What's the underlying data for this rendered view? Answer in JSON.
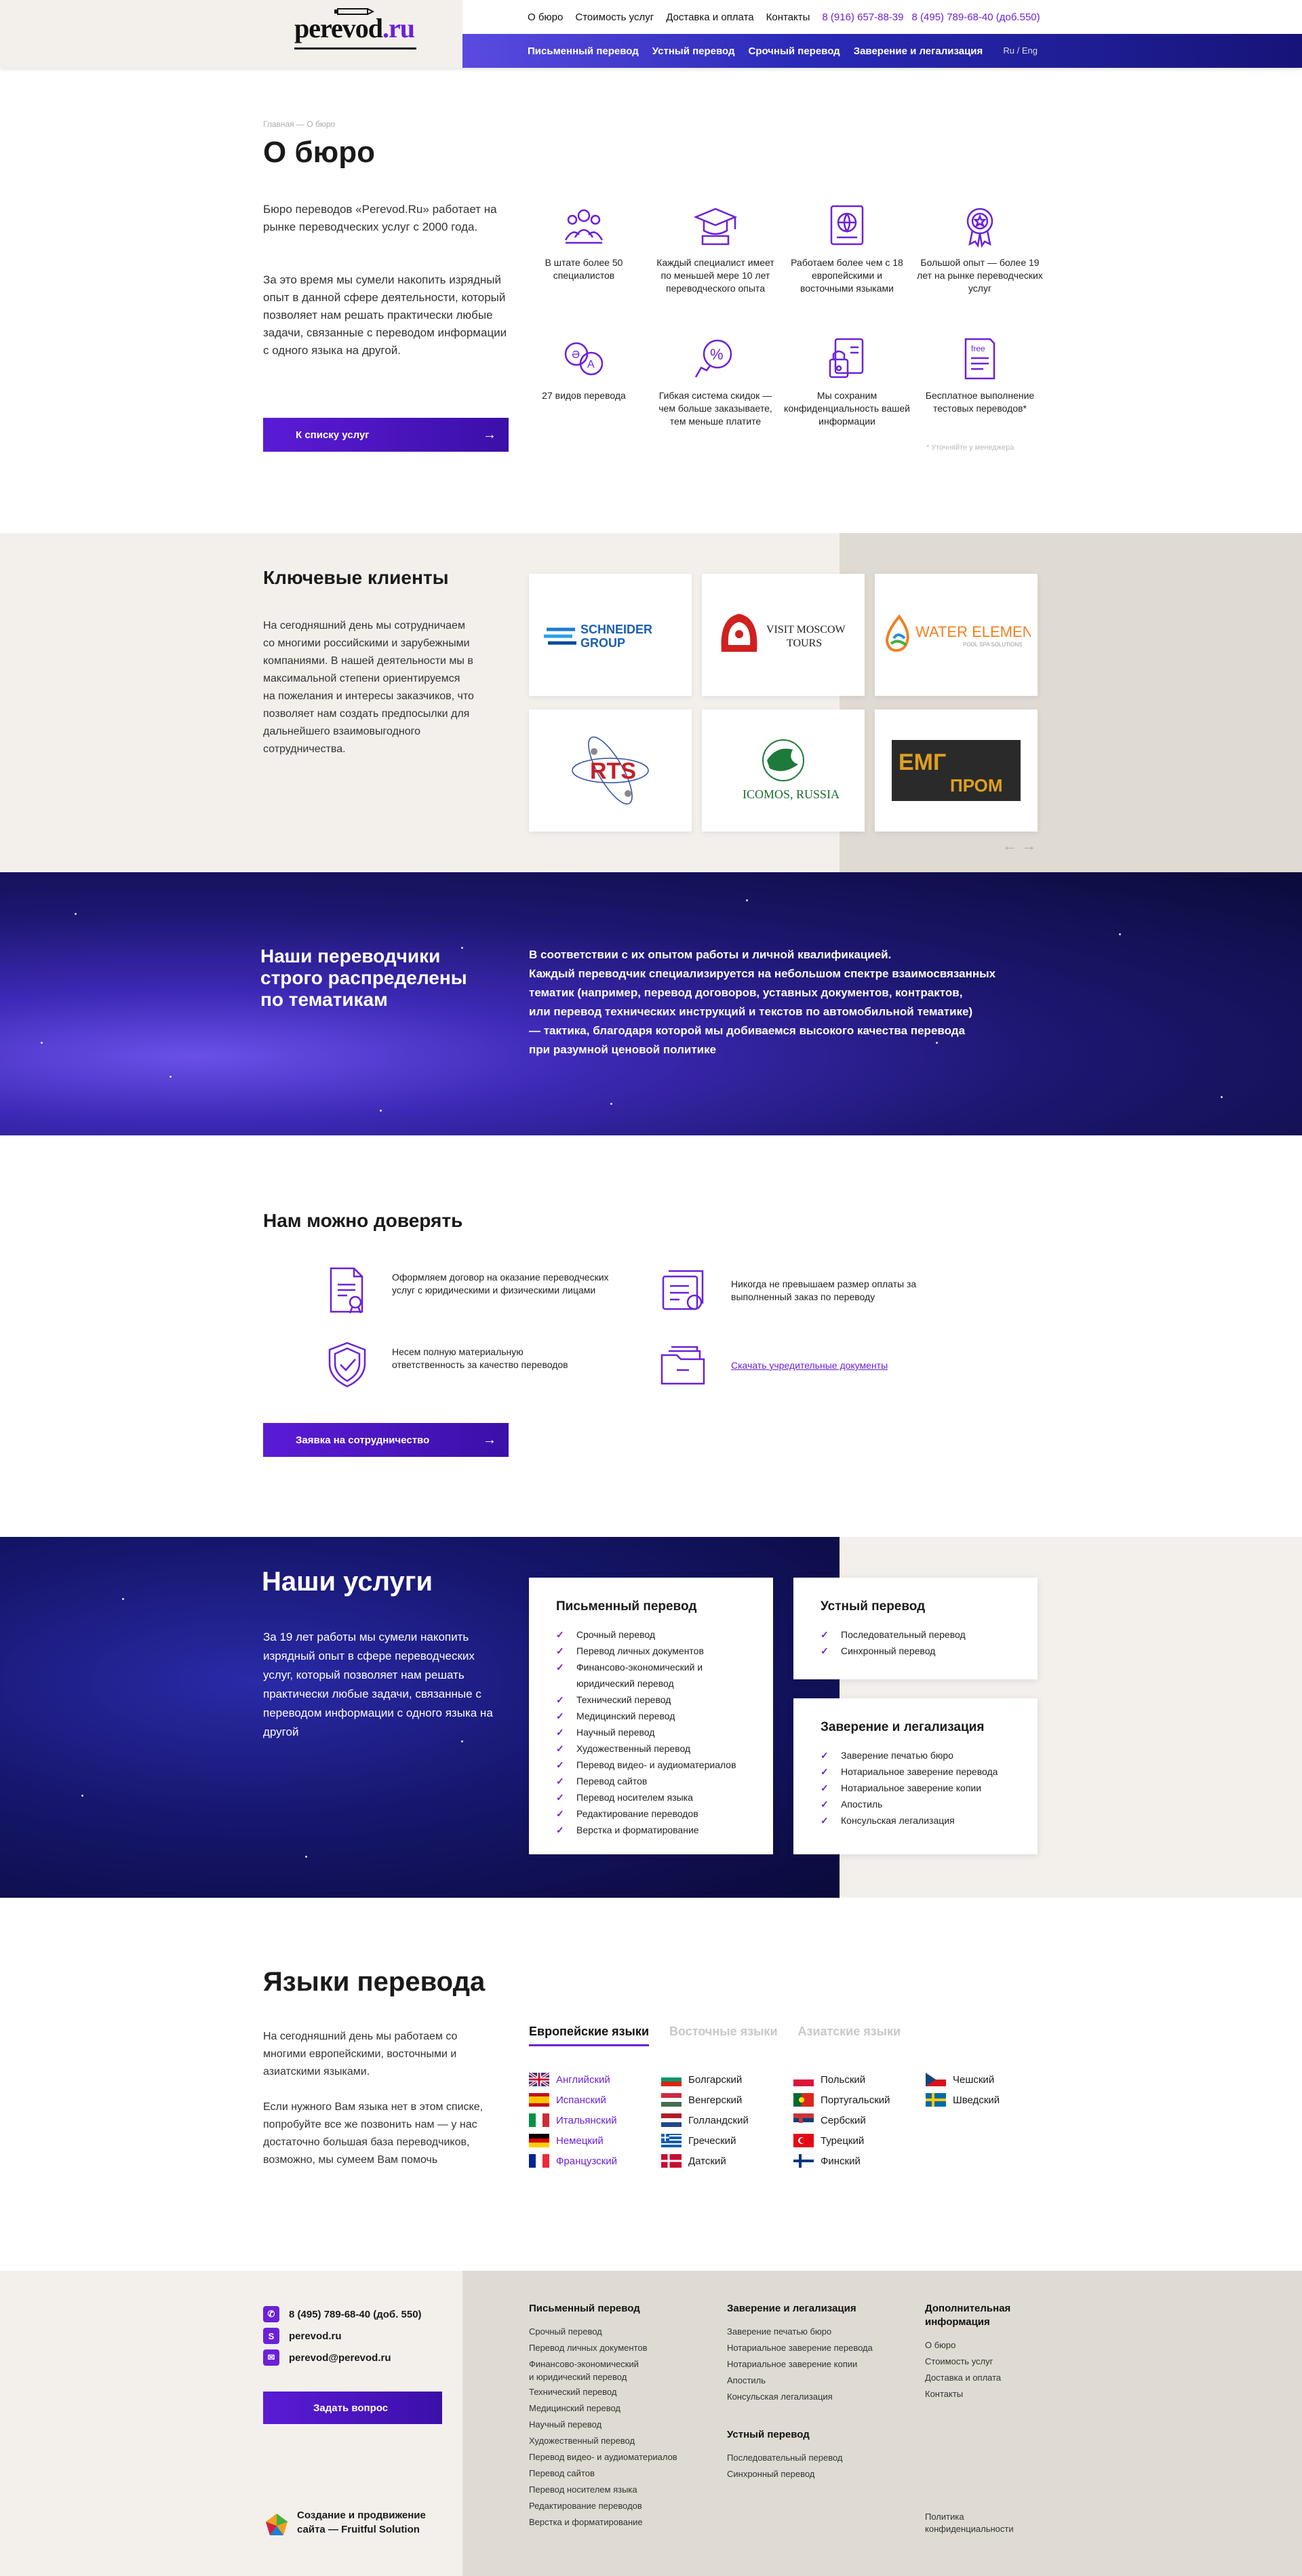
{
  "header": {
    "logo_main": "perevod",
    "logo_accent": ".ru",
    "top_nav": [
      "О бюро",
      "Стоимость услуг",
      "Доставка и оплата",
      "Контакты"
    ],
    "phones": [
      "8 (916) 657-88-39",
      "8 (495) 789-68-40 (доб.550)"
    ],
    "sub_nav": [
      "Письменный перевод",
      "Устный перевод",
      "Срочный перевод",
      "Заверение и легализация"
    ],
    "lang_switch": "Ru / Eng"
  },
  "about": {
    "breadcrumb": "Главная — О бюро",
    "title": "О бюро",
    "p1": "Бюро переводов «Perevod.Ru» работает на рынке переводческих услуг с 2000 года.",
    "p2": "За это время мы сумели накопить изрядный опыт в данной сфере деятельности, который позволяет нам решать практически любые задачи, связанные с переводом информации с одного языка на другой.",
    "button": "К списку услуг",
    "features": [
      {
        "icon": "team-icon",
        "text": "В штате более 50 специалистов"
      },
      {
        "icon": "graduation-icon",
        "text": "Каждый специалист имеет по меньшей мере 10 лет переводческого опыта"
      },
      {
        "icon": "globe-book-icon",
        "text": "Работаем более чем с 18 европейскими и восточными языками"
      },
      {
        "icon": "medal-icon",
        "text": "Большой опыт — более 19 лет на рынке переводческих услуг"
      },
      {
        "icon": "translate-icon",
        "text": "27 видов перевода"
      },
      {
        "icon": "percent-icon",
        "text": "Гибкая система скидок — чем больше заказываете, тем меньше платите"
      },
      {
        "icon": "lock-doc-icon",
        "text": "Мы сохраним конфиденциальность вашей информации"
      },
      {
        "icon": "free-doc-icon",
        "text": "Бесплатное выполнение тестовых переводов*"
      }
    ],
    "footnote": "* Уточняйте у менеджера"
  },
  "clients": {
    "title": "Ключевые клиенты",
    "text": "На сегодняшний день мы сотрудничаем со многими российскими и зарубежными компаниями. В нашей деятельности мы в максимальной степени ориентируемся на пожелания и интересы заказчиков, что позволяет нам создать предпосылки для дальнейшего взаимовыгодного сотрудничества.",
    "logos": [
      "SCHNEIDER GROUP",
      "VISIT MOSCOW TOURS",
      "WATER ELEMENTS",
      "RTS",
      "ICOMOS, RUSSIA",
      "ЕМГ ПРОМ"
    ],
    "arrows": "← →"
  },
  "translators": {
    "title": "Наши переводчики строго распределены по тематикам",
    "lines": [
      "В соответствии с их опытом работы и личной квалификацией.",
      "Каждый переводчик специализируется на небольшом спектре взаимосвязанных",
      "тематик (например, перевод договоров, уставных документов, контрактов,",
      "или перевод технических инструкций и текстов по автомобильной тематике)",
      "— тактика, благодаря которой мы добиваемся высокого качества перевода",
      "при разумной ценовой политике"
    ]
  },
  "trust": {
    "title": "Нам можно доверять",
    "items": [
      {
        "icon": "contract-icon",
        "text": "Оформляем договор на оказание переводческих услуг с юридическими и физическими лицами"
      },
      {
        "icon": "price-list-icon",
        "text": "Никогда не превышаем размер оплаты за выполненный заказ по переводу"
      },
      {
        "icon": "shield-icon",
        "text": "Несем полную материальную ответственность за качество переводов"
      },
      {
        "icon": "folder-icon",
        "text": "Скачать учредительные документы"
      }
    ],
    "button": "Заявка на сотрудничество"
  },
  "services": {
    "title": "Наши услуги",
    "text": "За 19 лет работы мы сумели накопить изрядный опыт в сфере переводческих услуг, который позволяет нам решать практически любые задачи, связанные с переводом информации с одного языка на другой",
    "written": {
      "title": "Письменный перевод",
      "items": [
        "Срочный перевод",
        "Перевод личных документов",
        "Финансово-экономический и юридический перевод",
        "Технический перевод",
        "Медицинский перевод",
        "Научный перевод",
        "Художественный перевод",
        "Перевод видео- и аудиоматериалов",
        "Перевод сайтов",
        "Перевод носителем языка",
        "Редактирование переводов",
        "Верстка и форматирование"
      ]
    },
    "oral": {
      "title": "Устный перевод",
      "items": [
        "Последовательный перевод",
        "Синхронный перевод"
      ]
    },
    "legal": {
      "title": "Заверение и легализация",
      "items": [
        "Заверение печатью бюро",
        "Нотариальное заверение перевода",
        "Нотариальное заверение копии",
        "Апостиль",
        "Консульская легализация"
      ]
    }
  },
  "languages": {
    "title": "Языки перевода",
    "p1": "На сегодняшний день мы работаем со многими европейскими, восточными и азиатскими языками.",
    "p2": "Если нужного Вам языка нет в этом списке, попробуйте все же позвонить нам — у нас достаточно большая база переводчиков, возможно, мы сумеем Вам помочь",
    "tabs": [
      "Европейские языки",
      "Восточные языки",
      "Азиатские языки"
    ],
    "columns": [
      [
        {
          "name": "Английский",
          "link": true,
          "flag": "gb"
        },
        {
          "name": "Испанский",
          "link": true,
          "flag": "es"
        },
        {
          "name": "Итальянский",
          "link": true,
          "flag": "it"
        },
        {
          "name": "Немецкий",
          "link": true,
          "flag": "de"
        },
        {
          "name": "Французский",
          "link": true,
          "flag": "fr"
        }
      ],
      [
        {
          "name": "Болгарский",
          "flag": "bg"
        },
        {
          "name": "Венгерский",
          "flag": "hu"
        },
        {
          "name": "Голландский",
          "flag": "nl"
        },
        {
          "name": "Греческий",
          "flag": "gr"
        },
        {
          "name": "Датский",
          "flag": "dk"
        }
      ],
      [
        {
          "name": "Польский",
          "flag": "pl"
        },
        {
          "name": "Португальский",
          "flag": "pt"
        },
        {
          "name": "Сербский",
          "flag": "rs"
        },
        {
          "name": "Турецкий",
          "flag": "tr"
        },
        {
          "name": "Финский",
          "flag": "fi"
        }
      ],
      [
        {
          "name": "Чешский",
          "flag": "cz"
        },
        {
          "name": "Шведский",
          "flag": "se"
        }
      ]
    ]
  },
  "footer": {
    "phone": "8 (495) 789-68-40 (доб. 550)",
    "skype": "perevod.ru",
    "email": "perevod@perevod.ru",
    "button": "Задать вопрос",
    "credit": "Создание и продвижение сайта — Fruitful Solution",
    "col1_title": "Письменный перевод",
    "col1": [
      "Срочный перевод",
      "Перевод личных документов",
      "Финансово-экономический",
      "и юридический перевод",
      "Технический перевод",
      "Медицинский перевод",
      "Научный перевод",
      "Художественный перевод",
      "Перевод видео- и аудиоматериалов",
      "Перевод сайтов",
      "Перевод носителем языка",
      "Редактирование переводов",
      "Верстка и форматирование"
    ],
    "col2_title": "Заверение и легализация",
    "col2": [
      "Заверение печатью бюро",
      "Нотариальное заверение перевода",
      "Нотариальное заверение копии",
      "Апостиль",
      "Консульская легализация"
    ],
    "col2b_title": "Устный перевод",
    "col2b": [
      "Последовательный перевод",
      "Синхронный перевод"
    ],
    "col3_title": "Дополнительная информация",
    "col3": [
      "О бюро",
      "Стоимость услуг",
      "Доставка и оплата",
      "Контакты"
    ],
    "privacy": "Политика конфиденциальности"
  },
  "colors": {
    "accent": "#6b21d8",
    "beige": "#f3f0ec",
    "beige_dark": "#dfdad2"
  }
}
